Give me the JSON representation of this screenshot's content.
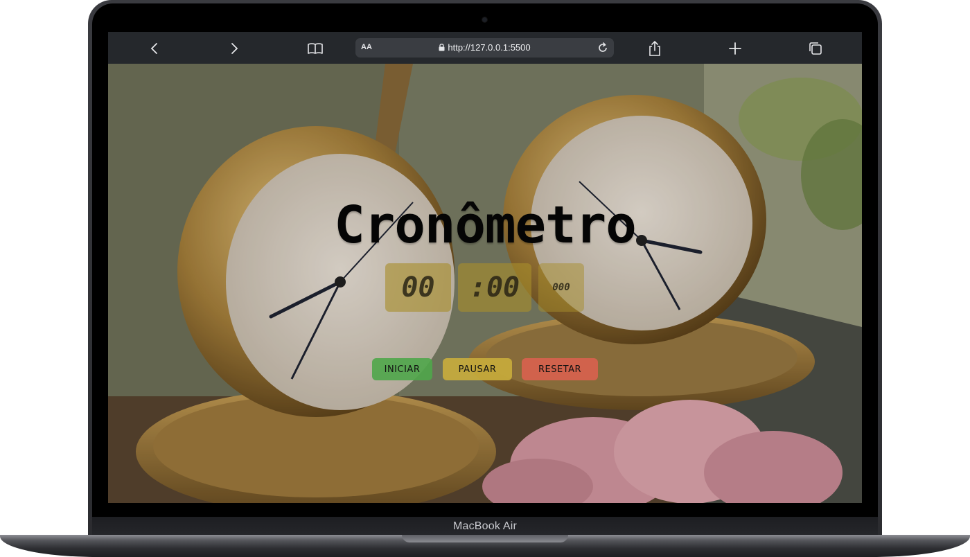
{
  "browser": {
    "url": "http://127.0.0.1:5500",
    "text_size_label": "AA"
  },
  "page": {
    "title": "Cronômetro",
    "minutes": "00",
    "seconds": ":00",
    "milliseconds": "000",
    "buttons": {
      "start": "INICIAR",
      "pause": "PAUSAR",
      "reset": "RESETAR"
    }
  },
  "device": {
    "label": "MacBook Air"
  },
  "colors": {
    "start": "#4fa64a",
    "pause": "#c9ad3c",
    "reset": "#d9624f",
    "toolbar": "#25282c"
  }
}
